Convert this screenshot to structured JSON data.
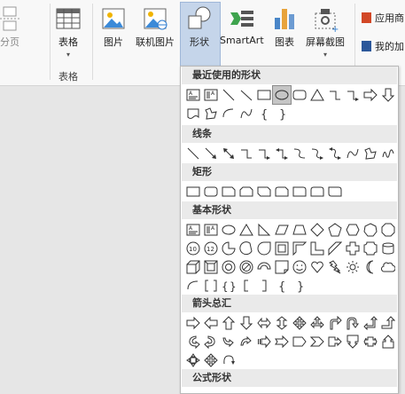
{
  "ribbon": {
    "page_break": "分页",
    "table": "表格",
    "table_group": "表格",
    "picture": "图片",
    "online_picture": "联机图片",
    "shapes": "形状",
    "smartart": "SmartArt",
    "chart": "图表",
    "screenshot": "屏幕截图",
    "app_store": "应用商",
    "my_addins": "我的加",
    "accent_blue": "#2b579a",
    "accent_orange": "#d24726"
  },
  "dropdown": {
    "sections": [
      {
        "title": "最近使用的形状",
        "rows": [
          [
            "text-box",
            "vertical-text-box",
            "line",
            "line-diag",
            "rectangle",
            "oval",
            "rounded-rect",
            "triangle",
            "elbow-connector",
            "elbow-arrow",
            "right-arrow",
            "down-arrow"
          ],
          [
            "flowchart-doc",
            "freeform",
            "arc",
            "curve",
            "left-brace",
            "right-brace"
          ]
        ]
      },
      {
        "title": "线条",
        "rows": [
          [
            "line",
            "arrow-line",
            "double-arrow-line",
            "elbow-connector",
            "elbow-arrow",
            "elbow-double-arrow",
            "curved-connector",
            "curved-arrow",
            "curved-double-arrow",
            "curve",
            "freeform",
            "scribble"
          ]
        ]
      },
      {
        "title": "矩形",
        "rows": [
          [
            "rectangle",
            "rounded-rect",
            "snip-single",
            "snip-same",
            "snip-diag",
            "snip-round",
            "round-single",
            "round-same",
            "round-diag"
          ]
        ]
      },
      {
        "title": "基本形状",
        "rows": [
          [
            "text-box",
            "vertical-text-box",
            "oval",
            "triangle",
            "right-triangle",
            "parallelogram",
            "trapezoid",
            "diamond",
            "pentagon",
            "hexagon",
            "heptagon",
            "octagon"
          ],
          [
            "decagon",
            "dodecagon",
            "pie",
            "chord",
            "teardrop",
            "frame",
            "half-frame",
            "l-shape",
            "diagonal-stripe",
            "cross",
            "plaque",
            "can"
          ],
          [
            "cube",
            "bevel",
            "donut",
            "no-symbol",
            "block-arc",
            "folded-corner",
            "smiley",
            "heart",
            "lightning",
            "sun",
            "moon",
            "cloud"
          ],
          [
            "arc",
            "double-bracket",
            "double-brace",
            "left-bracket",
            "right-bracket",
            "left-brace",
            "right-brace"
          ]
        ]
      },
      {
        "title": "箭头总汇",
        "rows": [
          [
            "right-arrow",
            "left-arrow",
            "up-arrow",
            "down-arrow",
            "left-right-arrow",
            "up-down-arrow",
            "quad-arrow",
            "left-right-up-arrow",
            "bent-arrow",
            "u-turn-arrow",
            "left-up-arrow",
            "bent-up-arrow"
          ],
          [
            "curved-right-arrow",
            "curved-left-arrow",
            "curved-up-arrow",
            "curved-down-arrow",
            "striped-right-arrow",
            "notched-right-arrow",
            "pentagon-arrow",
            "chevron",
            "right-arrow-callout",
            "down-arrow-callout",
            "left-right-arrow-callout",
            "up-arrow-callout"
          ],
          [
            "quad-arrow-callout",
            "quad-arrow-alt",
            "circular-arrow"
          ]
        ]
      },
      {
        "title": "公式形状",
        "rows": []
      }
    ]
  }
}
